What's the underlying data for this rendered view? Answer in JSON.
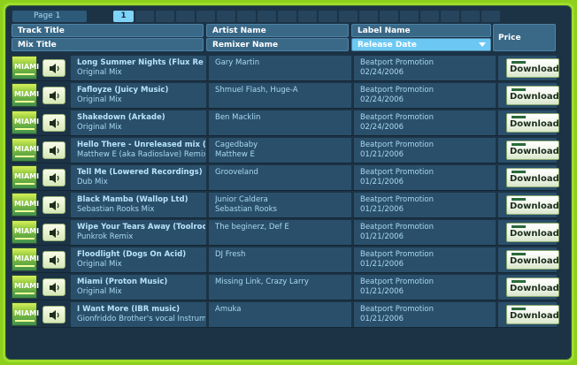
{
  "pager": {
    "label": "Page 1",
    "current": "1"
  },
  "headers": {
    "track_title": "Track Title",
    "mix_title": "Mix Title",
    "artist_name": "Artist Name",
    "remixer_name": "Remixer Name",
    "label_name": "Label Name",
    "release_date": "Release Date",
    "price": "Price"
  },
  "thumb_text": "MIAMI",
  "download_label": "Download",
  "rows": [
    {
      "track": "Long Summer Nights (Flux Re",
      "mix": "Original Mix",
      "artist": "Gary Martin",
      "remixer": "",
      "label": "Beatport Promotion",
      "date": "02/24/2006"
    },
    {
      "track": "Fafloyze (Juicy Music)",
      "mix": "Original Mix",
      "artist": "Shmuel Flash, Huge-A",
      "remixer": "",
      "label": "Beatport Promotion",
      "date": "02/24/2006"
    },
    {
      "track": "Shakedown (Arkade)",
      "mix": "Original Mix",
      "artist": "Ben Macklin",
      "remixer": "",
      "label": "Beatport Promotion",
      "date": "02/24/2006"
    },
    {
      "track": "Hello There - Unreleased mix (",
      "mix": "Matthew E (aka Radioslave) Remix",
      "artist": "Cagedbaby",
      "remixer": "Matthew E",
      "label": "Beatport Promotion",
      "date": "01/21/2006"
    },
    {
      "track": "Tell Me (Lowered Recordings)",
      "mix": "Dub Mix",
      "artist": "Grooveland",
      "remixer": "",
      "label": "Beatport Promotion",
      "date": "01/21/2006"
    },
    {
      "track": "Black Mamba (Wallop Ltd)",
      "mix": "Sebastian Rooks Mix",
      "artist": "Junior Caldera",
      "remixer": "Sebastian Rooks",
      "label": "Beatport Promotion",
      "date": "01/21/2006"
    },
    {
      "track": "Wipe Your Tears Away (Toolroo",
      "mix": "Punkrok Remix",
      "artist": "The beginerz, Def E",
      "remixer": "",
      "label": "Beatport Promotion",
      "date": "01/21/2006"
    },
    {
      "track": "Floodlight (Dogs On Acid)",
      "mix": "Original Mix",
      "artist": "DJ Fresh",
      "remixer": "",
      "label": "Beatport Promotion",
      "date": "01/21/2006"
    },
    {
      "track": "Miami (Proton Music)",
      "mix": "Original Mix",
      "artist": "Missing Link, Crazy Larry",
      "remixer": "",
      "label": "Beatport Promotion",
      "date": "01/21/2006"
    },
    {
      "track": "I Want More (IBR music)",
      "mix": "Gionfriddo Brother's vocal Instrume",
      "artist": "Amuka",
      "remixer": "",
      "label": "Beatport Promotion",
      "date": "01/21/2006"
    }
  ]
}
